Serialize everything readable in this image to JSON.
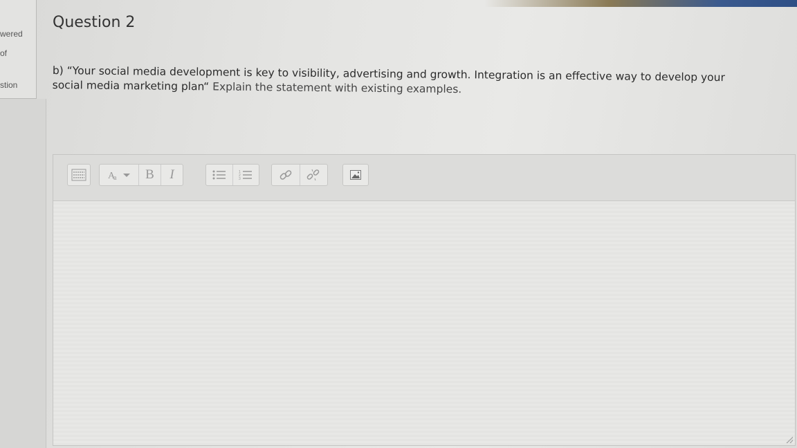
{
  "info_panel": {
    "line1": "wered",
    "line2": "of",
    "line3": "stion"
  },
  "question": {
    "title": "Question 2",
    "text_main": "b) “Your social media development is key to visibility, advertising and growth. Integration is an effective way to develop your social media marketing plan“",
    "text_rest": " Explain the statement with existing examples."
  },
  "editor": {
    "bold_label": "B",
    "italic_label": "I",
    "toolbar_icons": [
      "collapse-toolbar-icon",
      "font-style-icon",
      "bold-icon",
      "italic-icon",
      "unordered-list-icon",
      "ordered-list-icon",
      "link-icon",
      "unlink-icon",
      "image-icon"
    ],
    "content": ""
  }
}
